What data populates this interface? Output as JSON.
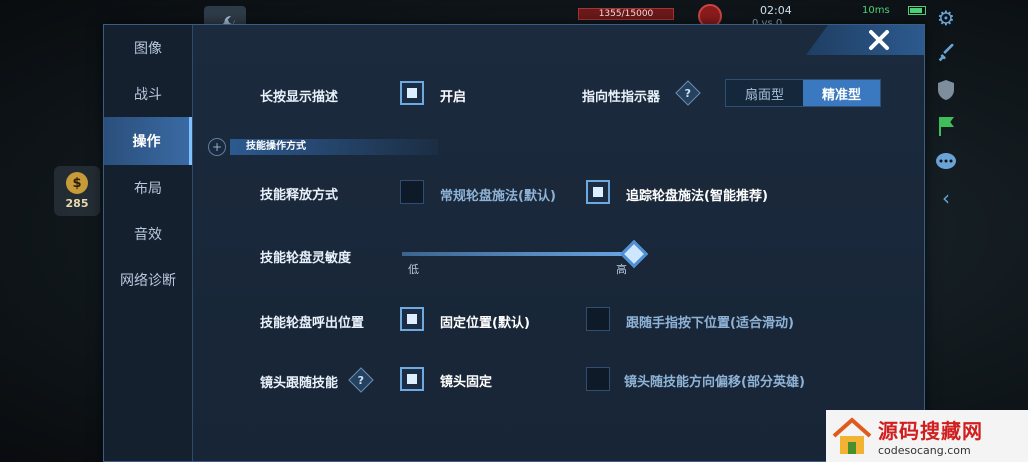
{
  "hud": {
    "hp_text": "1355/15000",
    "hp_fraction": 0.09,
    "clock": "02:04",
    "score": "0 vs 0",
    "ping": "10ms",
    "gold": "285"
  },
  "sidebar": {
    "tabs": [
      {
        "label": "图像",
        "active": false
      },
      {
        "label": "战斗",
        "active": false
      },
      {
        "label": "操作",
        "active": true
      },
      {
        "label": "布局",
        "active": false
      },
      {
        "label": "音效",
        "active": false
      },
      {
        "label": "网络诊断",
        "active": false
      }
    ]
  },
  "settings": {
    "long_press": {
      "label": "长按显示描述",
      "option": "开启",
      "checked": true
    },
    "indicator": {
      "label": "指向性指示器",
      "options": [
        "扇面型",
        "精准型"
      ],
      "selected": "精准型"
    },
    "section_title": "技能操作方式",
    "cast_mode": {
      "label": "技能释放方式",
      "options": [
        {
          "text": "常规轮盘施法(默认)",
          "checked": false
        },
        {
          "text": "追踪轮盘施法(智能推荐)",
          "checked": true
        }
      ]
    },
    "sensitivity": {
      "label": "技能轮盘灵敏度",
      "min_label": "低",
      "max_label": "高",
      "value": 1.0
    },
    "wheel_position": {
      "label": "技能轮盘呼出位置",
      "options": [
        {
          "text": "固定位置(默认)",
          "checked": true
        },
        {
          "text": "跟随手指按下位置(适合滑动)",
          "checked": false
        }
      ]
    },
    "camera_follow": {
      "label": "镜头跟随技能",
      "options": [
        {
          "text": "镜头固定",
          "checked": true
        },
        {
          "text": "镜头随技能方向偏移(部分英雄)",
          "checked": false
        }
      ]
    }
  },
  "watermark": {
    "title": "源码搜藏网",
    "url": "codesocang.com"
  },
  "colors": {
    "accent": "#3a78bf",
    "panel": "#1b2a3d",
    "active_tab": "#3a6aa3"
  },
  "icons": [
    "wrench-icon",
    "close-icon",
    "gear-icon",
    "sword-icon",
    "shield-icon",
    "flag-icon",
    "chat-icon",
    "chevron-left-icon",
    "help-icon",
    "gold-coin-icon"
  ]
}
